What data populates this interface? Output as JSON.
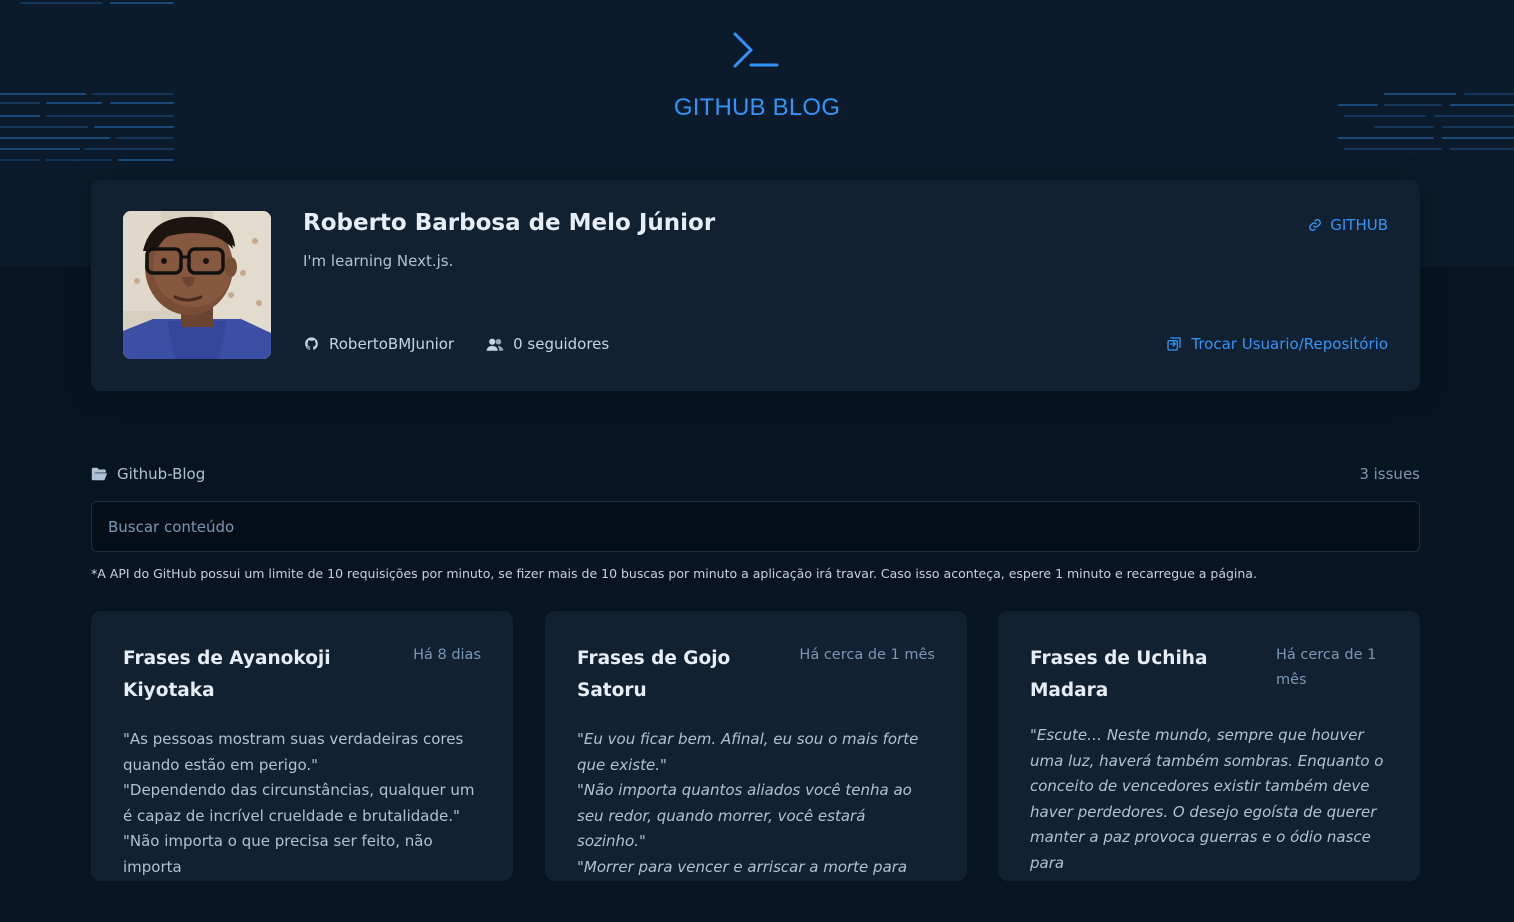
{
  "brand": {
    "title": "GITHUB BLOG"
  },
  "profile": {
    "name": "Roberto Barbosa de Melo Júnior",
    "bio": "I'm learning Next.js.",
    "github_link": "GITHUB",
    "username": "RobertoBMJunior",
    "followers": "0 seguidores",
    "swap_link": "Trocar Usuario/Repositório"
  },
  "repo": {
    "name": "Github-Blog",
    "issues": "3 issues"
  },
  "search": {
    "placeholder": "Buscar conteúdo"
  },
  "note": "*A API do GitHub possui um limite de 10 requisições por minuto, se fizer mais de 10 buscas por minuto a aplicação irá travar. Caso isso aconteça, espere 1 minuto e recarregue a página.",
  "posts": [
    {
      "title": "Frases de Ayanokoji Kiyotaka",
      "date": "Há 8 dias",
      "lines": [
        "\"As pessoas mostram suas verdadeiras cores quando estão em perigo.\"",
        "\"Dependendo das circunstâncias, qualquer um é capaz de incrível crueldade e brutalidade.\"",
        "\"Não importa o que precisa ser feito, não importa"
      ]
    },
    {
      "title": "Frases de Gojo Satoru",
      "date": "Há cerca de 1 mês",
      "lines": [
        "\"Eu vou ficar bem. Afinal, eu sou o mais forte que existe.\"",
        "\"Não importa quantos aliados você tenha ao seu redor, quando morrer, você estará sozinho.\"",
        "\"Morrer para vencer e arriscar a morte para"
      ]
    },
    {
      "title": "Frases de Uchiha Madara",
      "date": "Há cerca de 1 mês",
      "lines": [
        "\"Escute… Neste mundo, sempre que houver uma luz, haverá também sombras. Enquanto o conceito de vencedores existir também deve haver perdedores. O desejo egoísta de querer manter a paz provoca guerras e o ódio nasce para"
      ]
    }
  ],
  "colors": {
    "accent": "#3294f8",
    "background": "#071422",
    "header": "#0b1b2b",
    "card": "#112131"
  },
  "icons": {
    "logo": "terminal-prompt-icon",
    "github_link": "link-icon",
    "username": "github-icon",
    "followers": "users-icon",
    "swap": "swap-icon",
    "repo": "folder-open-icon"
  }
}
